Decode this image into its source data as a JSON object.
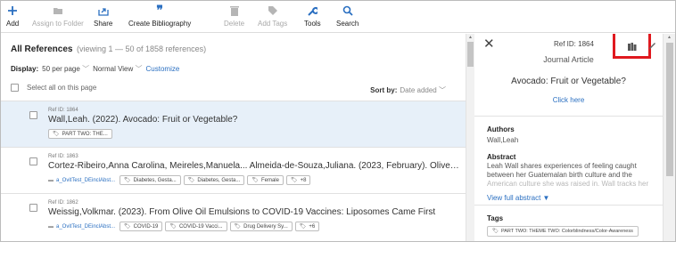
{
  "toolbar": {
    "add": "Add",
    "assign_to_folder": "Assign to Folder",
    "share": "Share",
    "create_bibliography": "Create Bibliography",
    "delete": "Delete",
    "add_tags": "Add Tags",
    "tools": "Tools",
    "search": "Search"
  },
  "list": {
    "title": "All References",
    "viewing": "(viewing 1 — 50 of 1858 references)",
    "display_label": "Display:",
    "per_page": "50 per page",
    "view_mode": "Normal View",
    "customize": "Customize",
    "select_all": "Select all on this page",
    "sort_label": "Sort by:",
    "sort_value": "Date added"
  },
  "references": [
    {
      "ref_id": "Ref ID: 1864",
      "title": "Wall,Leah. (2022). Avocado: Fruit or Vegetable?",
      "folder": "",
      "tags": [
        "PART TWO: THE..."
      ]
    },
    {
      "ref_id": "Ref ID: 1863",
      "title": "Cortez-Ribeiro,Anna Carolina, Meireles,Manuela... Almeida-de-Souza,Juliana. (2023, February). Olive oil consumption ...",
      "folder": "a_OvitTest_DEinclAbst...",
      "tags": [
        "Diabetes, Gesta...",
        "Diabetes, Gesta...",
        "Female",
        "+8"
      ]
    },
    {
      "ref_id": "Ref ID: 1862",
      "title": "Weissig,Volkmar. (2023). From Olive Oil Emulsions to COVID-19 Vaccines: Liposomes Came First",
      "folder": "a_OvitTest_DEinclAbst...",
      "tags": [
        "COVID-19",
        "COVID-19 Vacci...",
        "Drug Delivery Sy...",
        "+6"
      ]
    }
  ],
  "detail": {
    "ref_id": "Ref ID: 1864",
    "type": "Journal Article",
    "title": "Avocado: Fruit or Vegetable?",
    "link": "Click here",
    "authors_label": "Authors",
    "authors": "Wall,Leah",
    "abstract_label": "Abstract",
    "abstract_line1": "Leah Wall shares experiences of feeling caught",
    "abstract_line2": "between her Guatemalan birth culture and the",
    "abstract_line3": "American culture she was raised in. Wall tracks her",
    "view_full": "View full abstract ▼",
    "tags_label": "Tags",
    "tag": "PART TWO: THEME TWO: Colorblindness/Color-Awareness"
  },
  "colors": {
    "accent": "#2a6fc1",
    "selected_row": "#e7f0f9",
    "highlight": "#e0191f"
  }
}
